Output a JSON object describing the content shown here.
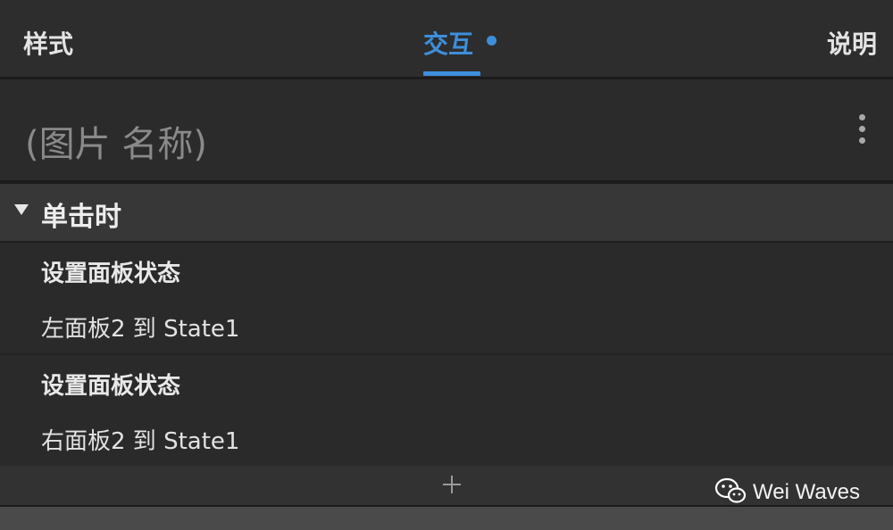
{
  "tabs": {
    "style_label": "样式",
    "interact_label": "交互",
    "notes_label": "说明",
    "active": "interact"
  },
  "element": {
    "name_placeholder": "(图片 名称)"
  },
  "event": {
    "label": "单击时",
    "actions": [
      {
        "title": "设置面板状态",
        "detail": "左面板2 到 State1"
      },
      {
        "title": "设置面板状态",
        "detail": "右面板2 到 State1"
      }
    ]
  },
  "footer": {
    "add_icon": "plus-icon"
  },
  "watermark": {
    "text": "Wei Waves"
  },
  "colors": {
    "accent": "#3d8fdc",
    "background": "#2a2a2a",
    "header_background": "#373737"
  }
}
